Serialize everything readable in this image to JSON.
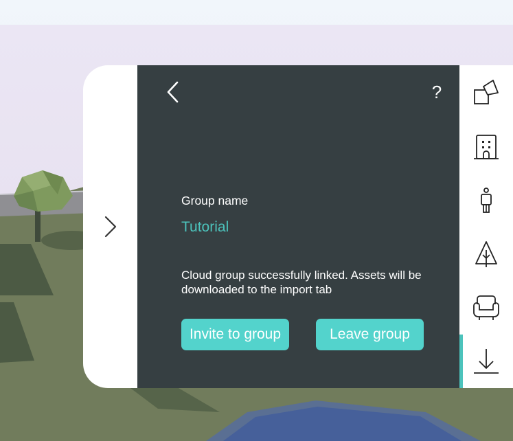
{
  "panel": {
    "group_label": "Group name",
    "group_value": "Tutorial",
    "status_message": "Cloud group successfully linked. Assets will be downloaded to the import tab",
    "invite_button": "Invite to group",
    "leave_button": "Leave group",
    "help_label": "?"
  },
  "toolbar": {
    "items": [
      "shapes-icon",
      "building-icon",
      "person-icon",
      "tree-icon",
      "armchair-icon",
      "download-icon"
    ],
    "active": "download-icon"
  },
  "colors": {
    "panel_bg": "#363f42",
    "accent": "#53d3cc",
    "accent_text": "#4cc3bc",
    "toolbar_bg": "#ffffff"
  }
}
